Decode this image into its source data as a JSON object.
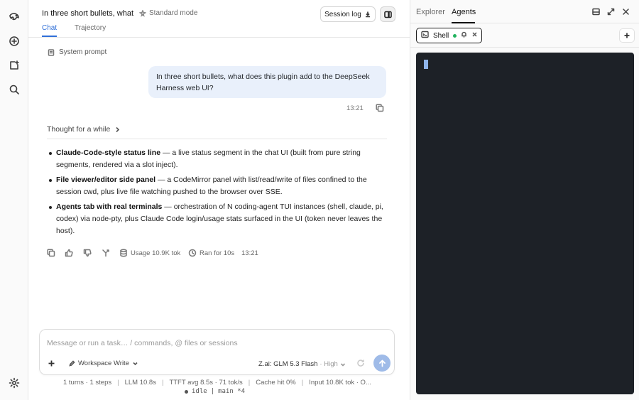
{
  "header": {
    "title": "In three short bullets, what",
    "mode": "Standard mode",
    "session_log": "Session log",
    "tabs": [
      {
        "label": "Chat",
        "active": true
      },
      {
        "label": "Trajectory",
        "active": false
      }
    ]
  },
  "chat": {
    "system_prompt": "System prompt",
    "user_message": "In three short bullets, what does this plugin add to the DeepSeek Harness web UI?",
    "user_time": "13:21",
    "thought": "Thought for a while",
    "bullets": [
      {
        "bold": "Claude-Code-style status line",
        "text": " — a live status segment in the chat UI (built from pure string segments, rendered via a slot inject)."
      },
      {
        "bold": "File viewer/editor side panel",
        "text": " — a CodeMirror panel with list/read/write of files confined to the session cwd, plus live file watching pushed to the browser over SSE."
      },
      {
        "bold": "Agents tab with real terminals",
        "text": " — orchestration of N coding-agent TUI instances (shell, claude, pi, codex) via node-pty, plus Claude Code login/usage stats surfaced in the UI (token never leaves the host)."
      }
    ],
    "usage": "Usage 10.9K tok",
    "ran_for": "Ran for 10s",
    "reply_time": "13:21"
  },
  "composer": {
    "placeholder": "Message or run a task… / commands, @ files or sessions",
    "value": "",
    "workspace": "Workspace Write",
    "model": "Z.ai: GLM 5.3 Flash",
    "effort": "· High"
  },
  "stats": [
    "1 turns · 1 steps",
    "LLM 10.8s",
    "TTFT avg 8.5s · 71 tok/s",
    "Cache hit 0%",
    "Input 10.8K tok · O..."
  ],
  "status_line": {
    "state": "idle",
    "branch": "main *4"
  },
  "right_panel": {
    "tabs": [
      {
        "label": "Explorer",
        "active": false
      },
      {
        "label": "Agents",
        "active": true
      }
    ],
    "terminal_tab": {
      "label": "Shell",
      "status_color": "#22b35e"
    }
  },
  "colors": {
    "accent": "#2f6fd8",
    "user_bubble": "#e9f0fb",
    "terminal_bg": "#1d2127",
    "send_button": "#9fbbe8"
  }
}
